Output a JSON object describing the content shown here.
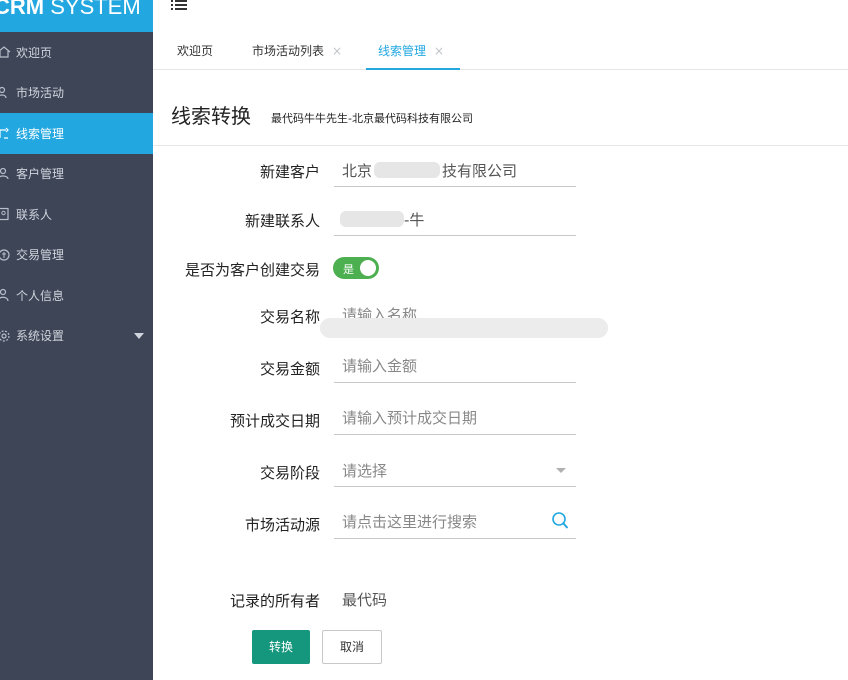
{
  "app": {
    "logo_bold": "CRM",
    "logo_rest": " SYSTEM"
  },
  "sidebar": {
    "items": [
      {
        "label": "欢迎页",
        "icon": "home-icon"
      },
      {
        "label": "市场活动",
        "icon": "users-icon"
      },
      {
        "label": "线索管理",
        "icon": "clue-icon",
        "active": true
      },
      {
        "label": "客户管理",
        "icon": "customer-icon"
      },
      {
        "label": "联系人",
        "icon": "contact-icon"
      },
      {
        "label": "交易管理",
        "icon": "transaction-icon"
      },
      {
        "label": "个人信息",
        "icon": "user-icon"
      },
      {
        "label": "系统设置",
        "icon": "settings-icon",
        "has_submenu": true
      }
    ]
  },
  "tabs": [
    {
      "label": "欢迎页",
      "closable": false
    },
    {
      "label": "市场活动列表",
      "closable": true
    },
    {
      "label": "线索管理",
      "closable": true,
      "active": true
    }
  ],
  "tab_close_glyph": "×",
  "page": {
    "title": "线索转换",
    "subtitle": "最代码牛牛先生-北京最代码科技有限公司"
  },
  "form": {
    "new_customer_label": "新建客户",
    "new_customer_value_a": "北京",
    "new_customer_value_b": "技有限公司",
    "new_contact_label": "新建联系人",
    "new_contact_value": "-牛",
    "create_deal_label": "是否为客户创建交易",
    "create_deal_toggle": "是",
    "deal_name_label": "交易名称",
    "deal_name_placeholder": "请输入名称",
    "deal_amount_label": "交易金额",
    "deal_amount_placeholder": "请输入金额",
    "expected_date_label": "预计成交日期",
    "expected_date_placeholder": "请输入预计成交日期",
    "stage_label": "交易阶段",
    "stage_value": "请选择",
    "source_label": "市场活动源",
    "source_placeholder": "请点击这里进行搜索",
    "owner_label": "记录的所有者",
    "owner_value": "最代码"
  },
  "buttons": {
    "convert": "转换",
    "cancel": "取消"
  },
  "colors": {
    "accent": "#22a7e0",
    "sidebar_bg": "#3d4557",
    "primary_button": "#14977d",
    "toggle_on": "#4caf50"
  }
}
